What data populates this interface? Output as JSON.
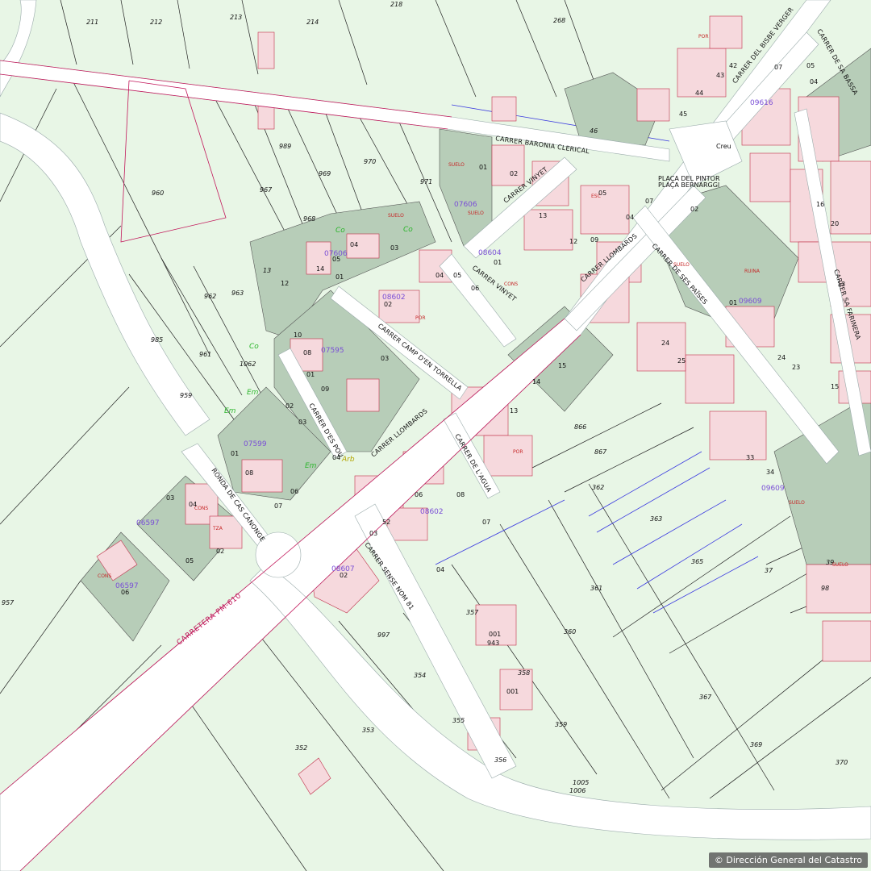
{
  "map": {
    "attribution": "© Dirección General del Catastro",
    "roads": [
      {
        "name": "CARRETERA PM-610",
        "kind": "highway"
      }
    ],
    "streets": [
      {
        "name": "CARRER BARONIA CLERICAL"
      },
      {
        "name": "CARRER VINYET"
      },
      {
        "name": "CARRER VINYET"
      },
      {
        "name": "CARRER CAMP D'EN TORRELLA"
      },
      {
        "name": "CARRER D'ES POU"
      },
      {
        "name": "CARRER LLOMBARDS"
      },
      {
        "name": "CARRER LLOMBARDS"
      },
      {
        "name": "CARRER DE SES PAÏSES"
      },
      {
        "name": "CARRER DE L'AGUA"
      },
      {
        "name": "CARRER SENSE NOM 81"
      },
      {
        "name": "RONDA DE CAS CANONGE"
      },
      {
        "name": "CARRER DEL BISBE VERGER"
      },
      {
        "name": "CARRER DE SA BASSA"
      },
      {
        "name": "CARRER SA FARINERA"
      }
    ],
    "places": [
      {
        "name": "PLAÇA DEL PINTOR"
      },
      {
        "name": "PLAÇA BERNARGGI"
      },
      {
        "name": "Creu"
      }
    ],
    "block_ids": [
      "07606",
      "07606",
      "08604",
      "08602",
      "07595",
      "07599",
      "06597",
      "06597",
      "08602",
      "08607",
      "09609",
      "09616",
      "09609"
    ],
    "parcel_numbers": [
      "211",
      "212",
      "213",
      "214",
      "218",
      "268",
      "960",
      "989",
      "967",
      "969",
      "970",
      "971",
      "968",
      "962",
      "963",
      "985",
      "961",
      "1062",
      "959",
      "957",
      "997",
      "354",
      "355",
      "356",
      "353",
      "352",
      "357",
      "358",
      "359",
      "360",
      "361",
      "362",
      "363",
      "365",
      "367",
      "369",
      "370",
      "866",
      "867",
      "1005",
      "1006",
      "46",
      "13",
      "37",
      "39",
      "98"
    ],
    "cultivation_codes": [
      "Co",
      "Co",
      "Co",
      "Em",
      "Em",
      "Em",
      "Arb"
    ],
    "use_codes": [
      "SUELO",
      "SUELO",
      "SUELO",
      "SUELO",
      "SUELO",
      "SUELO",
      "POR",
      "POR",
      "POR",
      "CONS",
      "CONS",
      "CONS",
      "RUINA",
      "ESC",
      "TZA"
    ]
  }
}
